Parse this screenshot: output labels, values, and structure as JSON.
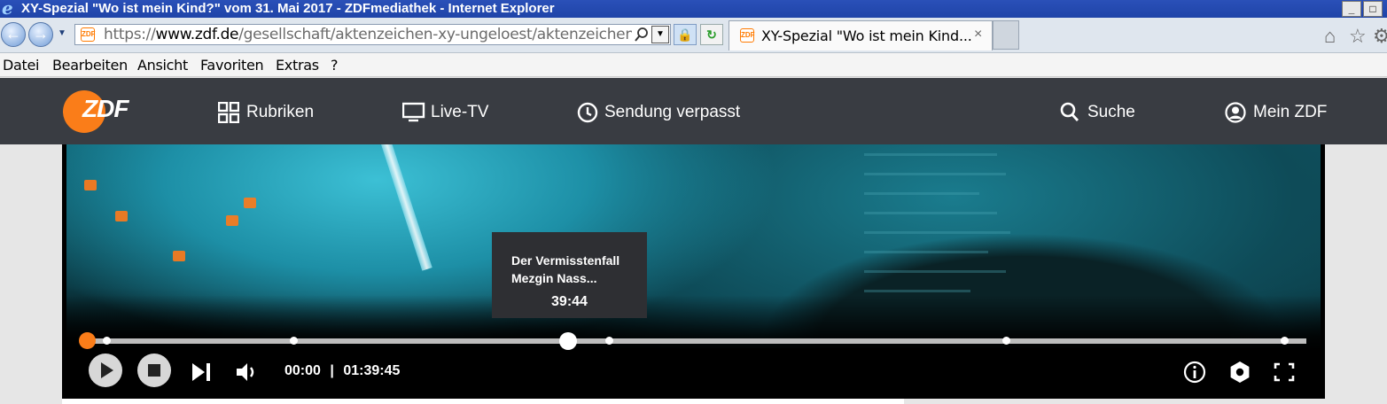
{
  "window": {
    "title": "XY-Spezial \"Wo ist mein Kind?\" vom 31. Mai 2017 - ZDFmediathek - Internet Explorer",
    "min_glyph": "_",
    "max_glyph": "□"
  },
  "addressbar": {
    "url_scheme": "https://",
    "url_host": "www.zdf.de",
    "url_path": "/gesellschaft/aktenzeichen-xy-ungeloest/aktenzeichen-xy-u",
    "tab_title": "XY-Spezial \"Wo ist mein Kind...",
    "tab_close": "×",
    "icons": [
      "back-arrow-icon",
      "forward-arrow-icon",
      "search-icon",
      "lock-icon",
      "refresh-icon",
      "home-icon",
      "star-icon",
      "gear-icon"
    ]
  },
  "menu": {
    "items": [
      "Datei",
      "Bearbeiten",
      "Ansicht",
      "Favoriten",
      "Extras",
      "?"
    ]
  },
  "zdf": {
    "logo_text": "ZDF",
    "brand_color": "#fa7d19",
    "header_bg": "#393c42",
    "nav": [
      {
        "label": "Rubriken",
        "icon": "grid-icon"
      },
      {
        "label": "Live-TV",
        "icon": "monitor-icon"
      },
      {
        "label": "Sendung verpasst",
        "icon": "clock-icon"
      },
      {
        "label": "Suche",
        "icon": "search-icon"
      },
      {
        "label": "Mein ZDF",
        "icon": "user-icon"
      }
    ]
  },
  "player": {
    "tooltip_title": "Der Vermisstenfall Mezgin Nass...",
    "tooltip_time": "39:44",
    "current_time": "00:00",
    "separator": "|",
    "duration": "01:39:45",
    "progress_fraction": 0.0,
    "hover_fraction": 0.398,
    "chapter_fractions": [
      0.022,
      0.174,
      0.431,
      0.755,
      0.982
    ],
    "controls": [
      "play-icon",
      "stop-icon",
      "next-chapter-icon",
      "volume-icon",
      "info-icon",
      "settings-icon",
      "fullscreen-icon"
    ]
  }
}
